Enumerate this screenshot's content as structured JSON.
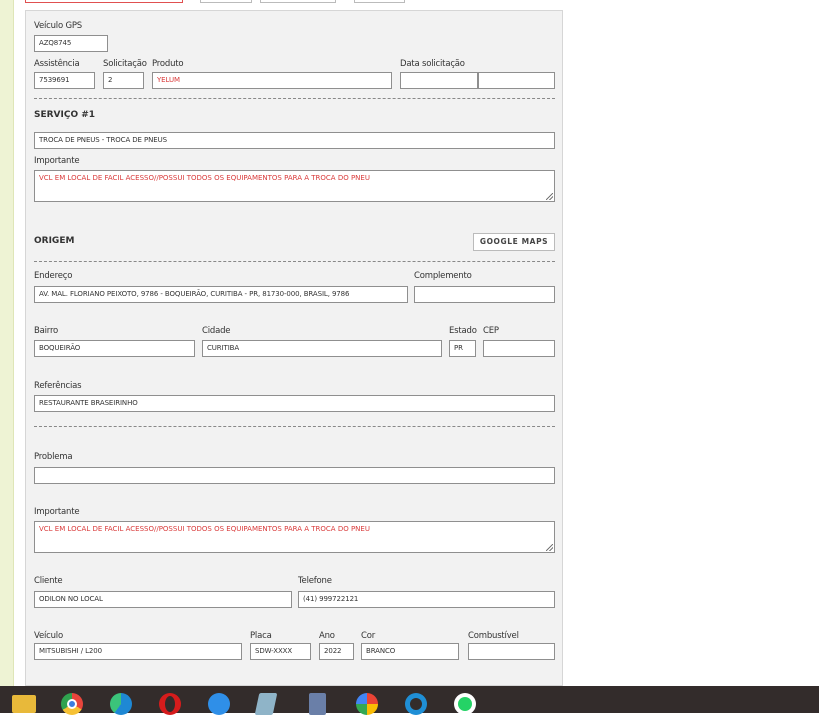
{
  "veiculo_gps": {
    "label": "Veículo GPS",
    "value": "AZQ8745"
  },
  "atendimento": {
    "assistencia": {
      "label": "Assistência",
      "value": "7539691"
    },
    "solicitacao": {
      "label": "Solicitação",
      "value": "2"
    },
    "produto": {
      "label": "Produto",
      "value": "YELUM"
    },
    "data_solicitacao": {
      "label": "Data solicitação",
      "date": "",
      "time": ""
    }
  },
  "servico": {
    "title": "SERVIÇO #1",
    "value": "TROCA DE PNEUS - TROCA DE PNEUS",
    "importante_label": "Importante",
    "importante": "VCL EM LOCAL DE FACIL ACESSO//POSSUI TODOS OS EQUIPAMENTOS PARA A TROCA DO PNEU"
  },
  "origem": {
    "title": "ORIGEM",
    "google_maps": "GOOGLE MAPS",
    "endereco": {
      "label": "Endereço",
      "value": "AV. MAL. FLORIANO PEIXOTO, 9786 - BOQUEIRÃO, CURITIBA - PR, 81730-000, BRASIL, 9786"
    },
    "complemento": {
      "label": "Complemento",
      "value": ""
    },
    "bairro": {
      "label": "Bairro",
      "value": "BOQUEIRÃO"
    },
    "cidade": {
      "label": "Cidade",
      "value": "CURITIBA"
    },
    "estado": {
      "label": "Estado",
      "value": "PR"
    },
    "cep": {
      "label": "CEP",
      "value": ""
    },
    "referencias": {
      "label": "Referências",
      "value": "RESTAURANTE BRASEIRINHO"
    }
  },
  "problema": {
    "label": "Problema",
    "value": "",
    "importante_label": "Importante",
    "importante": "VCL EM LOCAL DE FACIL ACESSO//POSSUI TODOS OS EQUIPAMENTOS PARA A TROCA DO PNEU"
  },
  "cliente": {
    "nome": {
      "label": "Cliente",
      "value": "ODILON NO LOCAL"
    },
    "telefone": {
      "label": "Telefone",
      "value": "(41) 999722121"
    }
  },
  "veiculo": {
    "modelo": {
      "label": "Veículo",
      "value": "MITSUBISHI / L200"
    },
    "placa": {
      "label": "Placa",
      "value": "SDW-XXXX"
    },
    "ano": {
      "label": "Ano",
      "value": "2022"
    },
    "cor": {
      "label": "Cor",
      "value": "BRANCO"
    },
    "combustivel": {
      "label": "Combustível",
      "value": ""
    }
  },
  "taskbar": {
    "icons": [
      "file-explorer-icon",
      "chrome-icon",
      "edge-icon",
      "opera-icon",
      "phone-icon",
      "notepad-icon",
      "calculator-icon",
      "google-maps-icon",
      "search-app-icon",
      "whatsapp-icon"
    ],
    "colors": {
      "chrome": "#e8453c",
      "edge": "#1e88d4",
      "opera": "#d61c1c",
      "whatsapp": "#25d366"
    }
  }
}
